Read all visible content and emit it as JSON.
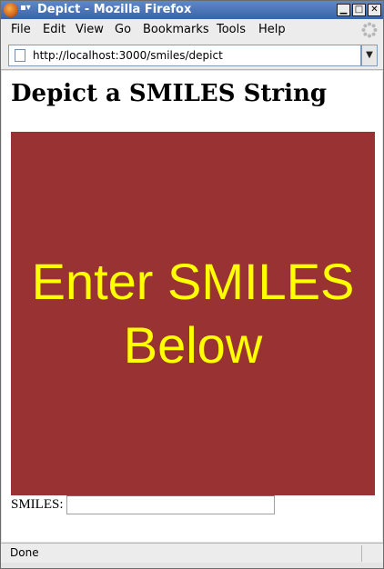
{
  "window": {
    "title": "Depict - Mozilla Firefox"
  },
  "menu": {
    "items": [
      "File",
      "Edit",
      "View",
      "Go",
      "Bookmarks",
      "Tools",
      "Help"
    ]
  },
  "urlbar": {
    "url": "http://localhost:3000/smiles/depict"
  },
  "page": {
    "heading": "Depict a SMILES String",
    "depict_line1": "Enter SMILES",
    "depict_line2": "Below",
    "smiles_label": "SMILES:",
    "smiles_value": ""
  },
  "status": {
    "text": "Done"
  },
  "colors": {
    "depict_bg": "#993333",
    "depict_text": "#ffff00",
    "titlebar": "#3a64a8"
  },
  "icons": [
    "firefox-logo-icon",
    "minimize-icon",
    "maximize-icon",
    "close-icon",
    "throbber-icon",
    "page-icon",
    "dropdown-arrow-icon"
  ]
}
